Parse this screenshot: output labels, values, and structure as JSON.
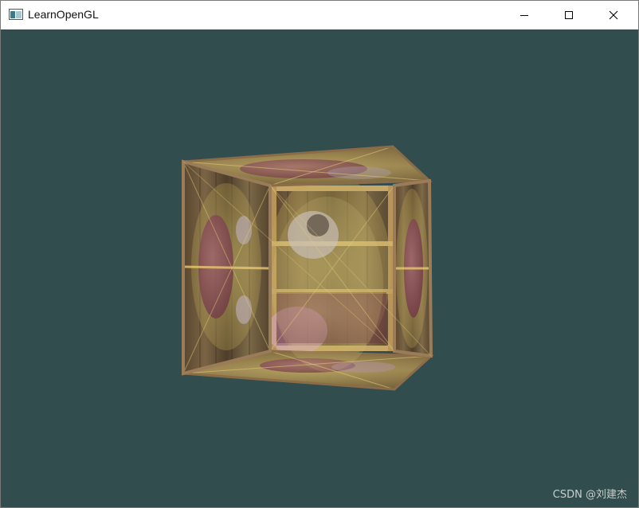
{
  "window": {
    "title": "LearnOpenGL",
    "controls": {
      "minimize_icon": "minimize-icon",
      "maximize_icon": "maximize-icon",
      "close_icon": "close-icon"
    }
  },
  "viewport": {
    "clear_color": "#324d4d",
    "content": "textured cube with transparency"
  },
  "watermark": "CSDN @刘建杰"
}
